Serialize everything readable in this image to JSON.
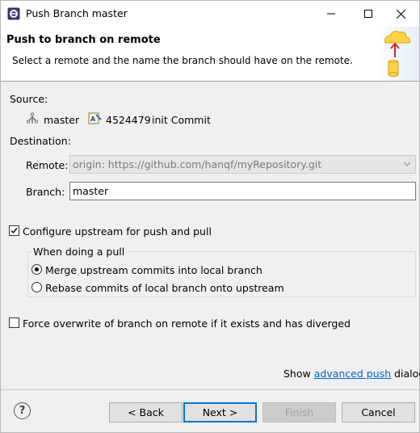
{
  "window": {
    "title": "Push Branch master"
  },
  "header": {
    "title": "Push to branch on remote",
    "description": "Select a remote and the name the branch should have on the remote."
  },
  "source": {
    "label": "Source:",
    "branch": "master",
    "commit_id": "4524479",
    "commit_message": "init Commit"
  },
  "destination": {
    "label": "Destination:",
    "remote_label": "Remote:",
    "remote_value": "origin: https://github.com/hanqf/myRepository.git",
    "branch_label": "Branch:",
    "branch_value": "master"
  },
  "upstream": {
    "checkbox_label": "Configure upstream for push and pull",
    "checked": true,
    "group_title": "When doing a pull",
    "options": [
      {
        "label": "Merge upstream commits into local branch",
        "selected": true
      },
      {
        "label": "Rebase commits of local branch onto upstream",
        "selected": false
      }
    ]
  },
  "force": {
    "label": "Force overwrite of branch on remote if it exists and has diverged",
    "checked": false
  },
  "advanced": {
    "prefix": "Show",
    "link": "advanced push",
    "suffix": "dialog"
  },
  "buttons": {
    "back": "< Back",
    "next": "Next >",
    "finish": "Finish",
    "cancel": "Cancel"
  },
  "icons": {
    "help": "?"
  }
}
